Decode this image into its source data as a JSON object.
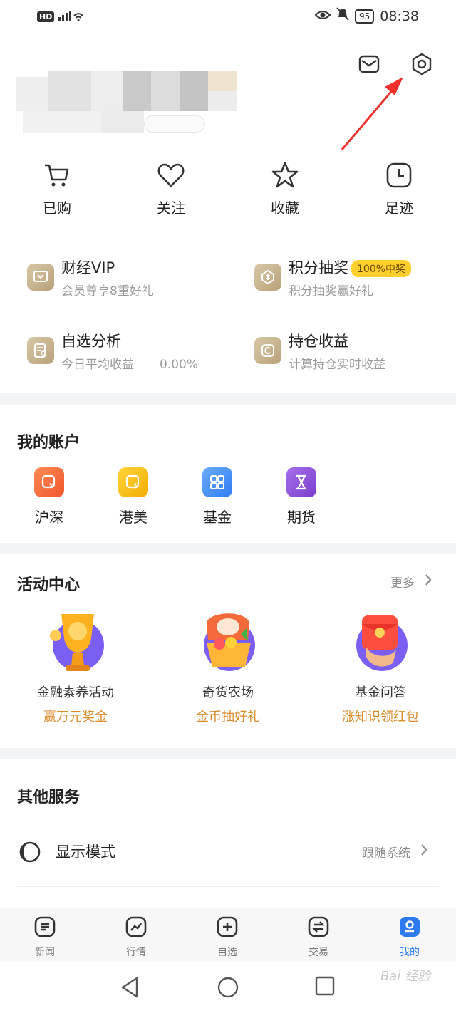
{
  "status_bar": {
    "network": "HD",
    "signal": "⁴ᴳ",
    "battery": "95",
    "time": "08:38"
  },
  "quick_actions": [
    {
      "label": "已购",
      "icon": "cart-icon"
    },
    {
      "label": "关注",
      "icon": "heart-icon"
    },
    {
      "label": "收藏",
      "icon": "star-icon"
    },
    {
      "label": "足迹",
      "icon": "clock-icon"
    }
  ],
  "features": [
    {
      "title": "财经VIP",
      "subtitle": "会员尊享8重好礼",
      "icon": "vip-icon"
    },
    {
      "title": "积分抽奖",
      "badge": "100%中奖",
      "subtitle": "积分抽奖赢好礼",
      "icon": "lottery-icon"
    },
    {
      "title": "自选分析",
      "subtitle": "今日平均收益",
      "value": "0.00%",
      "icon": "analysis-icon"
    },
    {
      "title": "持仓收益",
      "subtitle": "计算持仓实时收益",
      "icon": "holdings-icon"
    }
  ],
  "accounts": {
    "title": "我的账户",
    "items": [
      {
        "label": "沪深",
        "color": "#f26b3a"
      },
      {
        "label": "港美",
        "color": "#f5b800"
      },
      {
        "label": "基金",
        "color": "#3d8ef7"
      },
      {
        "label": "期货",
        "color": "#8b4fd6"
      }
    ]
  },
  "activities": {
    "title": "活动中心",
    "more": "更多",
    "items": [
      {
        "title": "金融素养活动",
        "subtitle": "赢万元奖金",
        "icon": "trophy-icon"
      },
      {
        "title": "奇货农场",
        "subtitle": "金币抽好礼",
        "icon": "farm-icon"
      },
      {
        "title": "基金问答",
        "subtitle": "涨知识领红包",
        "icon": "red-packet-icon"
      }
    ]
  },
  "services": {
    "title": "其他服务",
    "display_mode": {
      "label": "显示模式",
      "value": "跟随系统"
    }
  },
  "tabs": [
    {
      "label": "新闻",
      "icon": "news-icon"
    },
    {
      "label": "行情",
      "icon": "market-icon"
    },
    {
      "label": "自选",
      "icon": "add-icon"
    },
    {
      "label": "交易",
      "icon": "trade-icon"
    },
    {
      "label": "我的",
      "icon": "profile-icon",
      "active": true
    }
  ],
  "watermark": "Bai 经验"
}
